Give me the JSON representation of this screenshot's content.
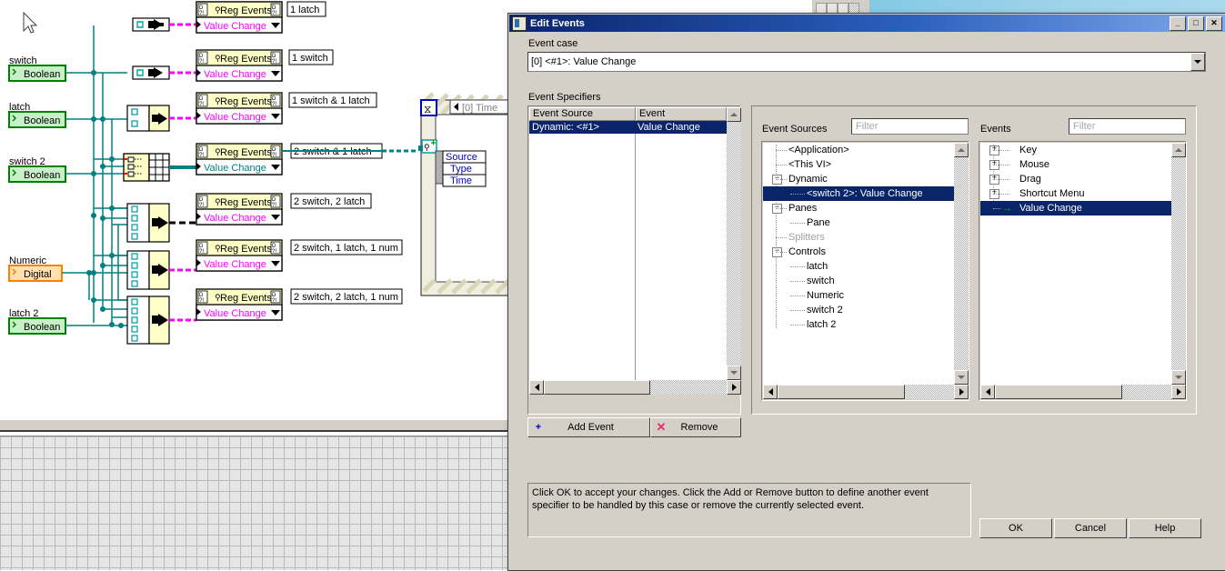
{
  "window": {
    "dialog_title": "Edit Events",
    "minimize": "_",
    "maximize": "□",
    "close": "✕"
  },
  "dialog": {
    "event_case_label": "Event case",
    "event_case_value": "[0] <#1>: Value Change",
    "event_specifiers_label": "Event Specifiers",
    "specifier_columns": [
      "Event Source",
      "Event"
    ],
    "specifier_rows": [
      {
        "source": "Dynamic: <#1>",
        "event": "Value Change",
        "selected": true
      }
    ],
    "event_sources_label": "Event Sources",
    "events_label": "Events",
    "filter_placeholder": "Filter",
    "event_sources_tree": [
      {
        "label": "<Application>",
        "depth": 1,
        "toggle": "none",
        "enabled": true,
        "selected": false
      },
      {
        "label": "<This VI>",
        "depth": 1,
        "toggle": "none",
        "enabled": true,
        "selected": false
      },
      {
        "label": "Dynamic",
        "depth": 1,
        "toggle": "minus",
        "enabled": true,
        "selected": false
      },
      {
        "label": "<switch 2>: Value Change",
        "depth": 2,
        "toggle": "none",
        "enabled": true,
        "selected": true
      },
      {
        "label": "Panes",
        "depth": 1,
        "toggle": "minus",
        "enabled": true,
        "selected": false
      },
      {
        "label": "Pane",
        "depth": 2,
        "toggle": "none",
        "enabled": true,
        "selected": false
      },
      {
        "label": "Splitters",
        "depth": 1,
        "toggle": "none",
        "enabled": false,
        "selected": false
      },
      {
        "label": "Controls",
        "depth": 1,
        "toggle": "minus",
        "enabled": true,
        "selected": false
      },
      {
        "label": "latch",
        "depth": 2,
        "toggle": "none",
        "enabled": true,
        "selected": false
      },
      {
        "label": "switch",
        "depth": 2,
        "toggle": "none",
        "enabled": true,
        "selected": false
      },
      {
        "label": "Numeric",
        "depth": 2,
        "toggle": "none",
        "enabled": true,
        "selected": false
      },
      {
        "label": "switch 2",
        "depth": 2,
        "toggle": "none",
        "enabled": true,
        "selected": false
      },
      {
        "label": "latch 2",
        "depth": 2,
        "toggle": "none",
        "enabled": true,
        "selected": false
      }
    ],
    "events_tree": [
      {
        "label": "Key",
        "toggle": "plus",
        "selected": false
      },
      {
        "label": "Mouse",
        "toggle": "plus",
        "selected": false
      },
      {
        "label": "Drag",
        "toggle": "plus",
        "selected": false
      },
      {
        "label": "Shortcut Menu",
        "toggle": "plus",
        "selected": false
      },
      {
        "label": "Value Change",
        "toggle": "arrow",
        "selected": true
      }
    ],
    "add_event_label": "Add Event",
    "add_event_icon": "+",
    "remove_label": "Remove",
    "remove_icon": "✕",
    "help_text": "Click OK to accept your changes.  Click the Add or Remove button to define another event specifier to be handled by this case or remove the currently selected event.",
    "ok_label": "OK",
    "cancel_label": "Cancel",
    "help_label": "Help"
  },
  "block_diagram": {
    "controls": [
      {
        "name": "switch",
        "type": "Boolean",
        "kind": "boolean"
      },
      {
        "name": "latch",
        "type": "Boolean",
        "kind": "boolean"
      },
      {
        "name": "switch 2",
        "type": "Boolean",
        "kind": "boolean"
      },
      {
        "name": "Numeric",
        "type": "Digital",
        "kind": "numeric"
      },
      {
        "name": "latch 2",
        "type": "Boolean",
        "kind": "boolean"
      }
    ],
    "reg_event_nodes": [
      {
        "title": "Reg Events",
        "event": "Value Change",
        "label": "1 latch"
      },
      {
        "title": "Reg Events",
        "event": "Value Change",
        "label": "1 switch"
      },
      {
        "title": "Reg Events",
        "event": "Value Change",
        "label": "1 switch & 1 latch"
      },
      {
        "title": "Reg Events",
        "event": "Value Change",
        "label": "2 switch & 1 latch"
      },
      {
        "title": "Reg Events",
        "event": "Value Change",
        "label": "2 switch,  2 latch"
      },
      {
        "title": "Reg Events",
        "event": "Value Change",
        "label": "2 switch,  1 latch, 1 num"
      },
      {
        "title": "Reg Events",
        "event": "Value Change",
        "label": "2 switch,  2 latch, 1 num"
      }
    ],
    "event_structure": {
      "case_label": "[0] Time",
      "terminals": [
        "Source",
        "Type",
        "Time"
      ]
    }
  },
  "colors": {
    "dialog_face": "#d4d0c8",
    "selection": "#0a246a",
    "wire_teal": "#008080",
    "wire_magenta": "#ff00ff",
    "boolean_green": "#008000",
    "numeric_orange": "#ff8000",
    "node_yellow": "#ffffc8",
    "titlebar_blue": "#0a246a"
  }
}
